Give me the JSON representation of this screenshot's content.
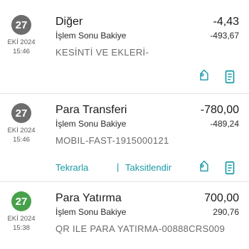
{
  "colors": {
    "accent": "#1b9aa6",
    "gray_badge": "#6d6d6d",
    "green_badge": "#47a14b"
  },
  "transactions": [
    {
      "day": "27",
      "month_year": "EKİ 2024",
      "time": "15:46",
      "title": "Diğer",
      "amount": "-4,43",
      "balance_label": "İşlem Sonu Bakiye",
      "balance": "-493,67",
      "description": "KESİNTİ VE EKLERİ-",
      "badge_color": "gray"
    },
    {
      "day": "27",
      "month_year": "EKİ 2024",
      "time": "15:46",
      "title": "Para Transferi",
      "amount": "-780,00",
      "balance_label": "İşlem Sonu Bakiye",
      "balance": "-489,24",
      "description": "MOBIL-FAST-1915000121",
      "badge_color": "gray",
      "actions": {
        "repeat": "Tekrarla",
        "separator": "|",
        "installment": "Taksitlendir"
      }
    },
    {
      "day": "27",
      "month_year": "EKİ 2024",
      "time": "15:38",
      "title": "Para Yatırma",
      "amount": "700,00",
      "balance_label": "İşlem Sonu Bakiye",
      "balance": "290,76",
      "description": "QR ILE PARA YATIRMA-00888CRS009",
      "badge_color": "green"
    }
  ],
  "icons": {
    "tag": "tag-icon",
    "receipt": "receipt-icon"
  }
}
